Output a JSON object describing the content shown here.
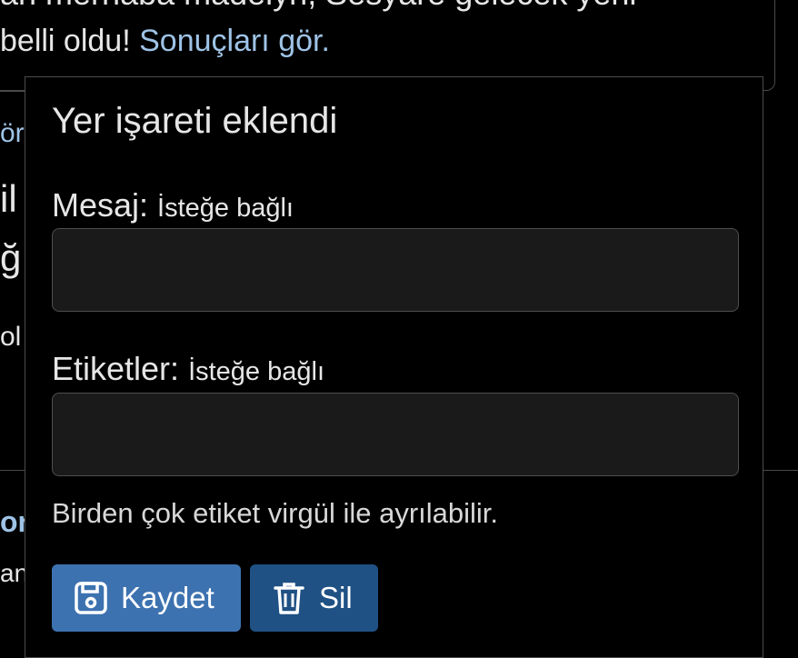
{
  "background": {
    "line1": "an merhaba madelyn, Sesyare gelecek yeni",
    "line2_text": "belli oldu! ",
    "line2_link": "Sonuçları gör.",
    "frag_gor": "ör",
    "frag_il": "il",
    "frag_g": "ğı",
    "frag_ol": "ol",
    "frag_or": "or.",
    "frag_an": "an"
  },
  "popup": {
    "title": "Yer işareti eklendi",
    "message": {
      "label": "Mesaj:",
      "optional": "İsteğe bağlı",
      "value": "",
      "placeholder": ""
    },
    "tags": {
      "label": "Etiketler:",
      "optional": "İsteğe bağlı",
      "value": "",
      "placeholder": ""
    },
    "help_text": "Birden çok etiket virgül ile ayrılabilir.",
    "buttons": {
      "save": {
        "label": "Kaydet",
        "icon": "floppy-disk-icon"
      },
      "delete": {
        "label": "Sil",
        "icon": "trash-icon"
      }
    }
  },
  "colors": {
    "background": "#000000",
    "link": "#9ec3e6",
    "save_button": "#3d72b0",
    "delete_button": "#1f5184",
    "input_background": "#1a1a1a"
  }
}
